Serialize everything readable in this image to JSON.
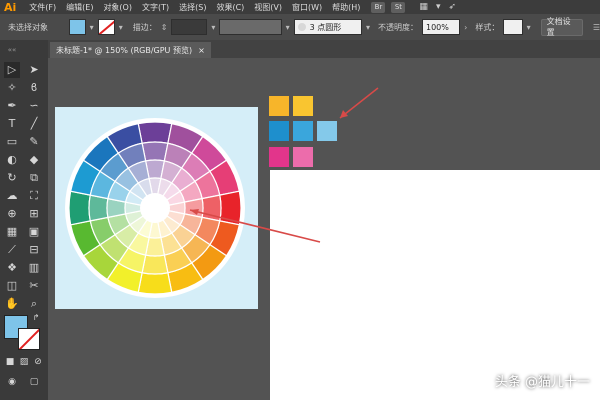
{
  "app": {
    "logo": "Ai"
  },
  "menu": [
    "文件(F)",
    "编辑(E)",
    "对象(O)",
    "文字(T)",
    "选择(S)",
    "效果(C)",
    "视图(V)",
    "窗口(W)",
    "帮助(H)"
  ],
  "app_badges": [
    "Br",
    "St"
  ],
  "control_bar": {
    "selection_label": "未选择对象",
    "stroke_label": "描边：",
    "brush_value": "3 点圆形",
    "opacity_label": "不透明度：",
    "opacity_value": "100%",
    "style_label": "样式：",
    "doc_settings_label": "文档设置",
    "fill_color": "#7ec4e9",
    "stroke_color": "#ffffff"
  },
  "document": {
    "tab_title": "未标题-1* @ 150% (RGB/GPU 预览)",
    "close_icon": "×"
  },
  "swatches": [
    {
      "color": "#f7b52a"
    },
    {
      "color": "#f9c530"
    },
    {
      "color": "#1e8fcd"
    },
    {
      "color": "#3aa6dc"
    },
    {
      "color": "#84c9ea"
    },
    {
      "color": "#e2358b"
    },
    {
      "color": "#ec6cab"
    }
  ],
  "color_wheel": {
    "palette": [
      "#6c3f98",
      "#a0509d",
      "#cf4a9a",
      "#e63e76",
      "#e8232a",
      "#ee5a1f",
      "#f39a12",
      "#f8bd12",
      "#f7dd1a",
      "#f2f02a",
      "#a8d63a",
      "#58b930",
      "#1f9e73",
      "#1d9bd2",
      "#1b76bd",
      "#3a4ea2"
    ]
  },
  "watermark": "头条 @猫儿十一",
  "icons": {
    "tools": [
      "selection-tool-icon",
      "direct-selection-tool-icon",
      "magic-wand-icon",
      "lasso-icon",
      "pen-icon",
      "curvature-icon",
      "type-icon",
      "line-icon",
      "rectangle-icon",
      "paintbrush-icon",
      "shaper-icon",
      "eraser-icon",
      "rotate-icon",
      "scale-icon",
      "warp-icon",
      "free-transform-icon",
      "shape-builder-icon",
      "perspective-icon",
      "mesh-icon",
      "gradient-icon",
      "eyedropper-icon",
      "blend-icon",
      "symbol-sprayer-icon",
      "column-graph-icon",
      "artboard-icon",
      "slice-icon",
      "hand-icon",
      "zoom-icon"
    ]
  }
}
